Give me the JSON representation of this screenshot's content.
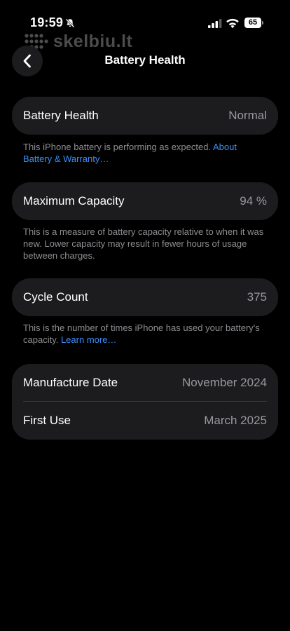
{
  "status_bar": {
    "time": "19:59",
    "battery_level": "65",
    "signal_bars_active": 3,
    "icons": [
      "bell-slash-icon",
      "cellular-signal-icon",
      "wifi-icon",
      "battery-icon"
    ]
  },
  "watermark": {
    "text": "skelbiu.lt"
  },
  "header": {
    "title": "Battery Health",
    "back_icon": "chevron-left-icon"
  },
  "battery_health": {
    "label": "Battery Health",
    "value": "Normal",
    "footnote": "This iPhone battery is performing as expected. ",
    "footnote_link": "About Battery & Warranty…"
  },
  "maximum_capacity": {
    "label": "Maximum Capacity",
    "value": "94 %",
    "footnote": "This is a measure of battery capacity relative to when it was new. Lower capacity may result in fewer hours of usage between charges."
  },
  "cycle_count": {
    "label": "Cycle Count",
    "value": "375",
    "footnote": "This is the number of times iPhone has used your battery's capacity. ",
    "footnote_link": "Learn more…"
  },
  "dates": {
    "manufacture_label": "Manufacture Date",
    "manufacture_value": "November 2024",
    "first_use_label": "First Use",
    "first_use_value": "March 2025"
  },
  "colors": {
    "background": "#000000",
    "card": "#1c1c1e",
    "secondary_text": "#8e8e93",
    "link": "#3b8ff7"
  }
}
